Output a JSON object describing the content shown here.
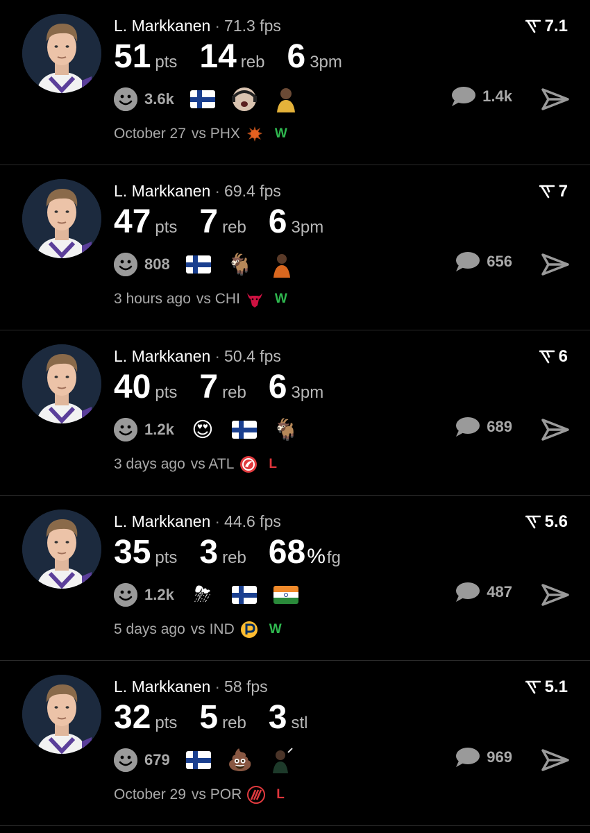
{
  "colors": {
    "win": "#2fb84f",
    "loss": "#e0353b",
    "muted": "#a9a9a9",
    "background": "#000000"
  },
  "posts": [
    {
      "player": "L. Markkanen",
      "fps": "71.3 fps",
      "score": "7.1",
      "stats": [
        {
          "num": "51",
          "unit": "pts"
        },
        {
          "num": "14",
          "unit": "reb"
        },
        {
          "num": "6",
          "unit": "3pm"
        }
      ],
      "reaction_count": "3.6k",
      "reactions": [
        "finland-flag",
        "streamer-face",
        "player-lakers"
      ],
      "comment_count": "1.4k",
      "date": "October 27",
      "vs": "vs PHX",
      "team_icon": "suns-logo",
      "result": "W"
    },
    {
      "player": "L. Markkanen",
      "fps": "69.4 fps",
      "score": "7",
      "stats": [
        {
          "num": "47",
          "unit": "pts"
        },
        {
          "num": "7",
          "unit": "reb"
        },
        {
          "num": "6",
          "unit": "3pm"
        }
      ],
      "reaction_count": "808",
      "reactions": [
        "finland-flag",
        "goat-emoji",
        "player-orange"
      ],
      "comment_count": "656",
      "date": "3 hours ago",
      "vs": "vs CHI",
      "team_icon": "bulls-logo",
      "result": "W"
    },
    {
      "player": "L. Markkanen",
      "fps": "50.4 fps",
      "score": "6",
      "stats": [
        {
          "num": "40",
          "unit": "pts"
        },
        {
          "num": "7",
          "unit": "reb"
        },
        {
          "num": "6",
          "unit": "3pm"
        }
      ],
      "reaction_count": "1.2k",
      "reactions": [
        "heart-eyes-emoji",
        "finland-flag",
        "goat-emoji"
      ],
      "comment_count": "689",
      "date": "3 days ago",
      "vs": "vs ATL",
      "team_icon": "hawks-logo",
      "result": "L"
    },
    {
      "player": "L. Markkanen",
      "fps": "44.6 fps",
      "score": "5.6",
      "stats": [
        {
          "num": "35",
          "unit": "pts"
        },
        {
          "num": "3",
          "unit": "reb"
        },
        {
          "num": "68",
          "unit": "%",
          "unit2": "fg"
        }
      ],
      "reaction_count": "1.2k",
      "reactions": [
        "storm-cloud-emoji",
        "finland-flag",
        "india-flag"
      ],
      "comment_count": "487",
      "date": "5 days ago",
      "vs": "vs IND",
      "team_icon": "pacers-logo",
      "result": "W"
    },
    {
      "player": "L. Markkanen",
      "fps": "58 fps",
      "score": "5.1",
      "stats": [
        {
          "num": "32",
          "unit": "pts"
        },
        {
          "num": "5",
          "unit": "reb"
        },
        {
          "num": "3",
          "unit": "stl"
        }
      ],
      "reaction_count": "679",
      "reactions": [
        "finland-flag",
        "poop-emoji",
        "player-dark"
      ],
      "comment_count": "969",
      "date": "October 29",
      "vs": "vs POR",
      "team_icon": "blazers-logo",
      "result": "L"
    }
  ]
}
